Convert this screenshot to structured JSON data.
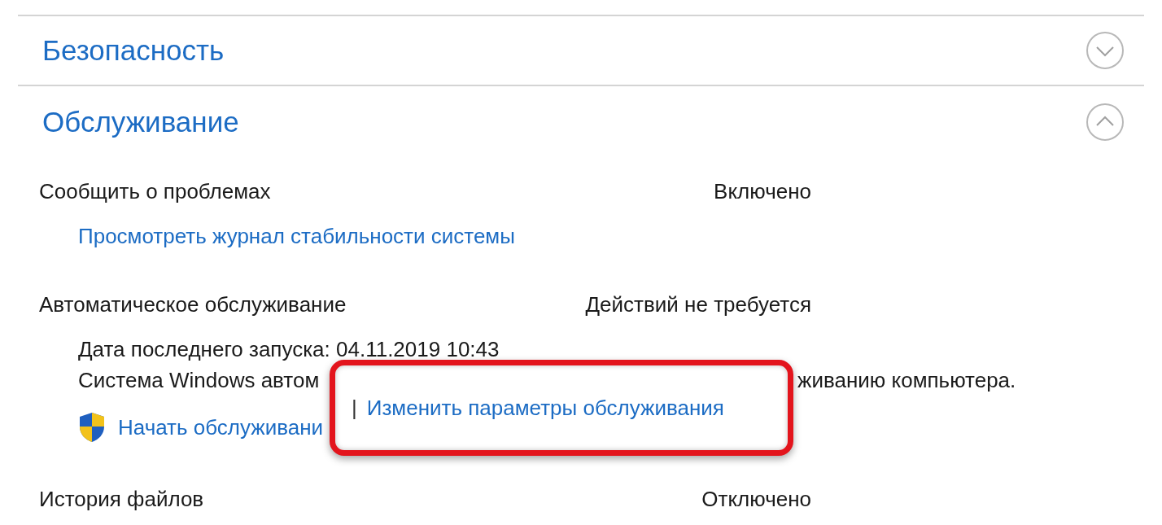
{
  "sections": [
    {
      "title": "Безопасность",
      "expanded": false
    },
    {
      "title": "Обслуживание",
      "expanded": true,
      "items": [
        {
          "kind": "simple",
          "label": "Сообщить о проблемах",
          "status": "Включено",
          "links": [
            "Просмотреть журнал стабильности системы"
          ]
        },
        {
          "kind": "maintenance",
          "label": "Автоматическое обслуживание",
          "status": "Действий не требуется",
          "details": [
            "Дата последнего запуска: 04.11.2019 10:43"
          ],
          "note_parts": [
            "Система Windows автом",
            "живанию компьютера."
          ],
          "start_link": "Начать обслуживани",
          "separator": "|",
          "change_link": "Изменить параметры обслуживания"
        },
        {
          "kind": "simple",
          "label": "История файлов",
          "status": "Отключено"
        }
      ]
    }
  ]
}
